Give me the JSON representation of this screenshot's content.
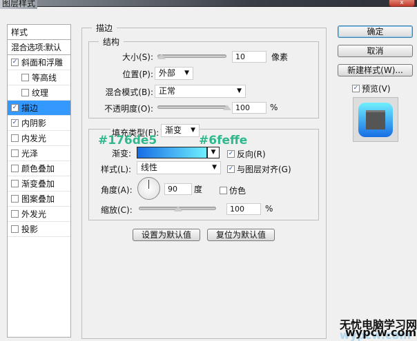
{
  "window": {
    "title": "图层样式",
    "close": "x"
  },
  "sidebar": {
    "header": "样式",
    "blend": "混合选项:默认",
    "items": [
      {
        "label": "斜面和浮雕",
        "checked": true,
        "indent": false
      },
      {
        "label": "等高线",
        "checked": false,
        "indent": true
      },
      {
        "label": "纹理",
        "checked": false,
        "indent": true
      },
      {
        "label": "描边",
        "checked": true,
        "indent": false,
        "selected": true
      },
      {
        "label": "内阴影",
        "checked": true,
        "indent": false
      },
      {
        "label": "内发光",
        "checked": false,
        "indent": false
      },
      {
        "label": "光泽",
        "checked": false,
        "indent": false
      },
      {
        "label": "颜色叠加",
        "checked": false,
        "indent": false
      },
      {
        "label": "渐变叠加",
        "checked": false,
        "indent": false
      },
      {
        "label": "图案叠加",
        "checked": false,
        "indent": false
      },
      {
        "label": "外发光",
        "checked": false,
        "indent": false
      },
      {
        "label": "投影",
        "checked": false,
        "indent": false
      }
    ]
  },
  "stroke": {
    "title": "描边",
    "structure": {
      "title": "结构",
      "size_label": "大小(S):",
      "size": "10",
      "size_unit": "像素",
      "size_fraction": 0.05,
      "position_label": "位置(P):",
      "position": "外部",
      "blend_label": "混合模式(B):",
      "blend": "正常",
      "opacity_label": "不透明度(O):",
      "opacity": "100",
      "opacity_unit": "%",
      "opacity_fraction": 1.0
    },
    "fill": {
      "type_label": "填充类型(F):",
      "type": "渐变",
      "gradient_label": "渐变:",
      "gradient_start": "#176de5",
      "gradient_end": "#6feffe",
      "reverse_label": "反向(R)",
      "reverse": true,
      "style_label": "样式(L):",
      "style": "线性",
      "align_label": "与图层对齐(G)",
      "align": true,
      "angle_label": "角度(A):",
      "angle": "90",
      "angle_unit": "度",
      "dither_label": "仿色",
      "dither": false,
      "scale_label": "缩放(C):",
      "scale": "100",
      "scale_unit": "%",
      "scale_fraction": 0.5
    },
    "set_default": "设置为默认值",
    "reset_default": "复位为默认值"
  },
  "annotations": {
    "start": "#176de5",
    "end": "#6feffe"
  },
  "right": {
    "ok": "确定",
    "cancel": "取消",
    "new_style": "新建样式(W)...",
    "preview_label": "预览(V)",
    "preview": true
  },
  "watermark": {
    "line1": "无忧电脑学习网",
    "line2": "wypcw.com"
  }
}
